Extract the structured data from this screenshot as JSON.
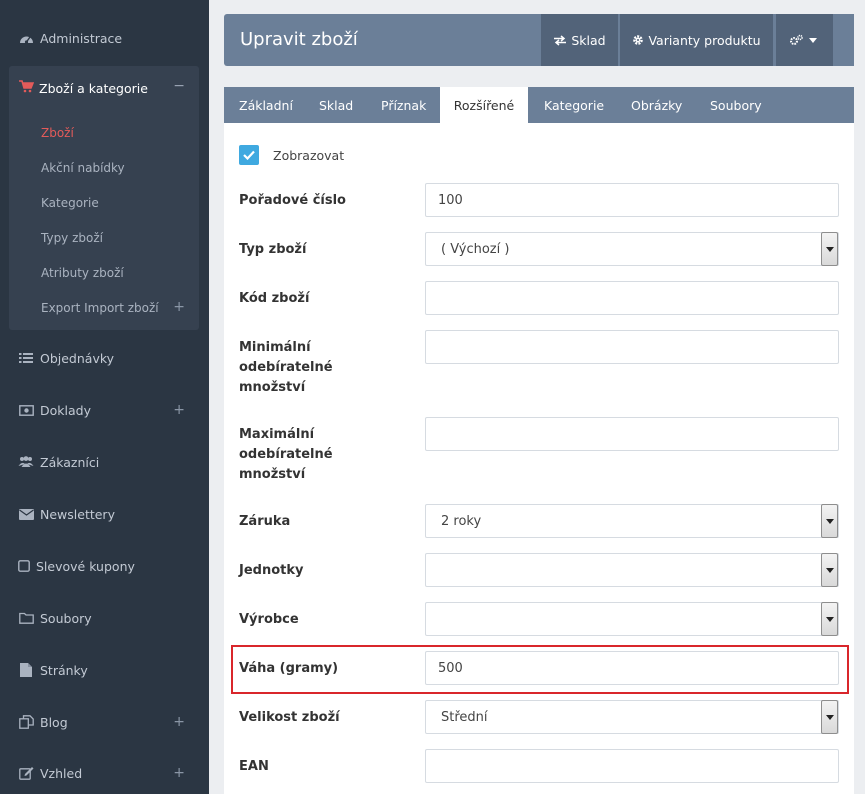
{
  "sidebar": {
    "top_items": [
      {
        "label": "Administrace",
        "icon": "dashboard-icon"
      }
    ],
    "active_group": {
      "label": "Zboží a kategorie",
      "icon": "shopping-cart-icon",
      "subitems": [
        "Zboží",
        "Akční nabídky",
        "Kategorie",
        "Typy zboží",
        "Atributy zboží",
        "Export Import zboží"
      ],
      "active_subitem": "Zboží"
    },
    "items": [
      {
        "label": "Objednávky",
        "icon": "list-icon"
      },
      {
        "label": "Doklady",
        "icon": "money-icon"
      },
      {
        "label": "Zákazníci",
        "icon": "users-icon"
      },
      {
        "label": "Newslettery",
        "icon": "envelope-icon"
      },
      {
        "label": "Slevové kupony",
        "icon": "square-icon"
      },
      {
        "label": "Soubory",
        "icon": "folder-icon"
      },
      {
        "label": "Stránky",
        "icon": "file-icon"
      },
      {
        "label": "Blog",
        "icon": "copy-icon"
      },
      {
        "label": "Vzhled",
        "icon": "edit-icon"
      }
    ]
  },
  "header": {
    "title": "Upravit zboží",
    "btn_sklad": "Sklad",
    "btn_varianty": "Varianty produktu"
  },
  "tabs": [
    "Základní",
    "Sklad",
    "Příznak",
    "Rozšířené",
    "Kategorie",
    "Obrázky",
    "Soubory"
  ],
  "active_tab": "Rozšířené",
  "form": {
    "show_label": "Zobrazovat",
    "show_checked": true,
    "order_label": "Pořadové číslo",
    "order_value": "100",
    "type_label": "Typ zboží",
    "type_value": "( Výchozí )",
    "code_label": "Kód zboží",
    "code_value": "",
    "min_label": "Minimální odebíratelné množství",
    "min_value": "",
    "max_label": "Maximální odebíratelné množství",
    "max_value": "",
    "warranty_label": "Záruka",
    "warranty_value": "2 roky",
    "units_label": "Jednotky",
    "units_value": "",
    "maker_label": "Výrobce",
    "maker_value": "",
    "weight_label": "Váha (gramy)",
    "weight_value": "500",
    "size_label": "Velikost zboží",
    "size_value": "Střední",
    "ean_label": "EAN",
    "ean_value": ""
  },
  "colors": {
    "sidebar_bg": "#2b3643",
    "accent": "#e35b5a",
    "header_bg": "#6b7f98",
    "checkbox": "#3fa9e0",
    "highlight": "#d9262b"
  }
}
